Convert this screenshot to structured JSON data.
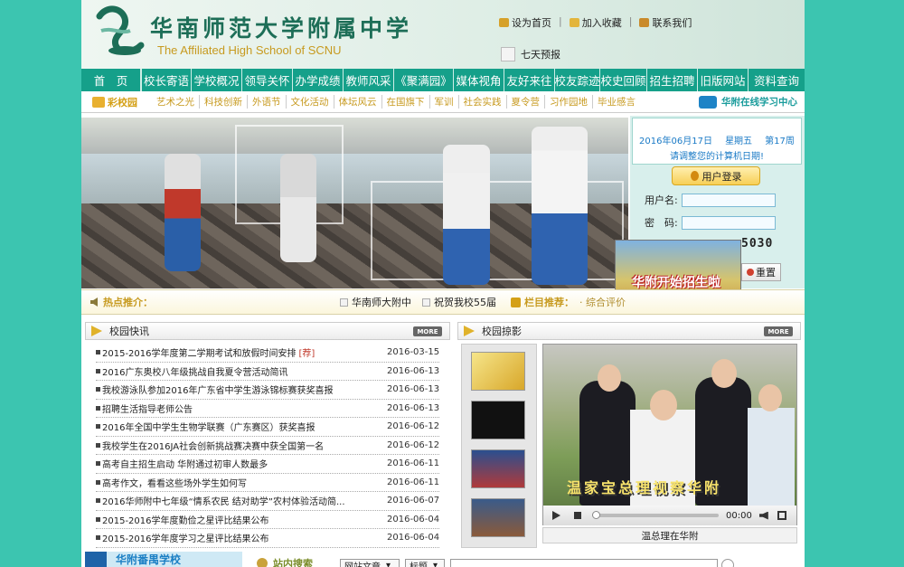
{
  "header": {
    "school_cn": "华南师范大学附属中学",
    "school_en": "The Affiliated High School of SCNU",
    "top_links": [
      "设为首页",
      "加入收藏",
      "联系我们"
    ],
    "weather": "七天预报"
  },
  "nav": {
    "items": [
      "首　页",
      "校长寄语",
      "学校概况",
      "领导关怀",
      "办学成绩",
      "教师风采",
      "《聚满园》",
      "媒体视角",
      "友好来往",
      "校友踪迹",
      "校史回顾",
      "招生招聘",
      "旧版网站",
      "资料查询"
    ]
  },
  "subnav": {
    "badge": "彩校园",
    "links": [
      "艺术之光",
      "科技创新",
      "外语节",
      "文化活动",
      "体坛风云",
      "在国旗下",
      "军训",
      "社会实践",
      "夏令营",
      "习作园地",
      "毕业感言"
    ],
    "istudy": "华附在线学习中心"
  },
  "panel": {
    "date": "2016年06月17日",
    "weekday": "星期五",
    "week": "第17周",
    "note": "请调整您的计算机日期!",
    "login_title": "用户登录",
    "username_label": "用户名:",
    "password_label": "密　码:",
    "verify_code": "5030",
    "reset_label": "重置",
    "ad_text": "华附开始招生啦"
  },
  "hotbar": {
    "label": "热点推介：",
    "items": [
      "华南师大附中",
      "祝贺我校55届"
    ],
    "column_label": "栏目推荐：",
    "column_item": "· 综合评价"
  },
  "news": {
    "title": "校园快讯",
    "more": "MORE",
    "items": [
      {
        "title": "2015-2016学年度第二学期考试和放假时间安排",
        "tag": "[荐]",
        "date": "2016-03-15"
      },
      {
        "title": "2016广东奥校八年级挑战自我夏令营活动简讯",
        "tag": "",
        "date": "2016-06-13"
      },
      {
        "title": "我校游泳队参加2016年广东省中学生游泳锦标赛获奖喜报",
        "tag": "",
        "date": "2016-06-13"
      },
      {
        "title": "招聘生活指导老师公告",
        "tag": "",
        "date": "2016-06-13"
      },
      {
        "title": "2016年全国中学生生物学联赛（广东赛区）获奖喜报",
        "tag": "",
        "date": "2016-06-12"
      },
      {
        "title": "我校学生在2016JA社会创新挑战赛决赛中获全国第一名",
        "tag": "",
        "date": "2016-06-12"
      },
      {
        "title": "高考自主招生启动 华附通过初审人数最多",
        "tag": "",
        "date": "2016-06-11"
      },
      {
        "title": "高考作文，看看这些场外学生如何写",
        "tag": "",
        "date": "2016-06-11"
      },
      {
        "title": "2016华师附中七年级“情系农民 结对助学”农村体验活动简...",
        "tag": "",
        "date": "2016-06-07"
      },
      {
        "title": "2015-2016学年度勤俭之星评比结果公布",
        "tag": "",
        "date": "2016-06-04"
      },
      {
        "title": "2015-2016学年度学习之星评比结果公布",
        "tag": "",
        "date": "2016-06-04"
      }
    ]
  },
  "photos": {
    "title": "校园掠影",
    "more": "MORE",
    "video_caption": "温家宝总理视察华附",
    "video_time": "00:00",
    "video_title": "温总理在华附"
  },
  "bottom": {
    "school": "华附番禺学校",
    "search_label": "站内搜索",
    "select1": "网站文章",
    "select2": "标题"
  },
  "colors": {
    "page_bg": "#3cc5b0",
    "nav_bg": "#15a08a",
    "accent_gold": "#c79a1f"
  }
}
